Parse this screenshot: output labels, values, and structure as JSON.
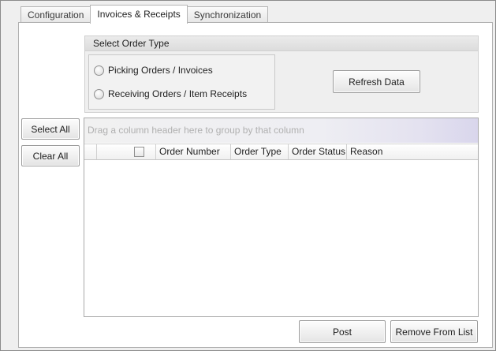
{
  "tabs": [
    {
      "label": "Configuration",
      "active": false
    },
    {
      "label": "Invoices & Receipts",
      "active": true
    },
    {
      "label": "Synchronization",
      "active": false
    }
  ],
  "order_type": {
    "title": "Select Order Type",
    "options": [
      {
        "label": "Picking Orders / Invoices",
        "selected": false
      },
      {
        "label": "Receiving Orders / Item Receipts",
        "selected": false
      }
    ]
  },
  "buttons": {
    "refresh": "Refresh Data",
    "select_all": "Select All",
    "clear_all": "Clear All",
    "post": "Post",
    "remove": "Remove From List"
  },
  "grid": {
    "group_panel_text": "Drag a column header here to group by that column",
    "columns": [
      "Order Number",
      "Order Type",
      "Order Status",
      "Reason"
    ],
    "rows": []
  }
}
